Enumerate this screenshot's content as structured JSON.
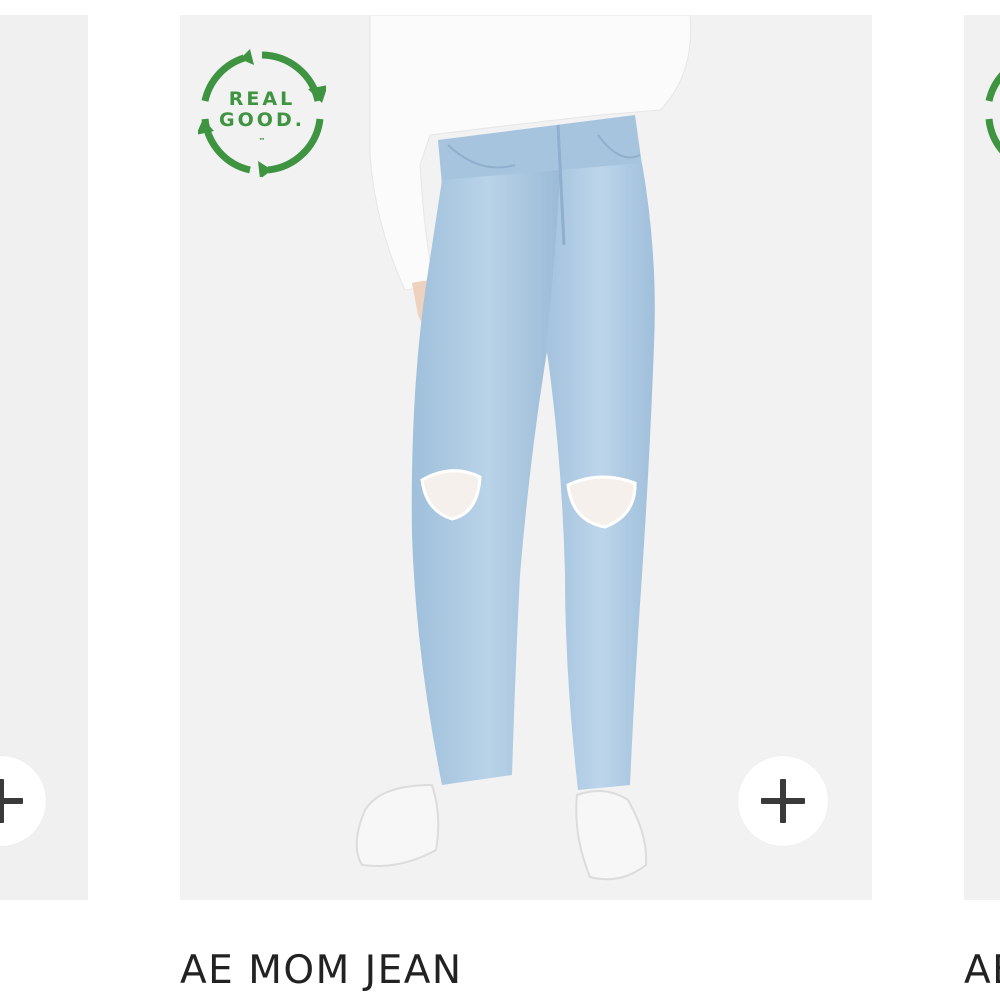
{
  "products": [
    {
      "position": "left-partial",
      "icons": {
        "quick_add": "plus-icon"
      }
    },
    {
      "position": "center",
      "name": "AE MOM JEAN",
      "badge": {
        "line1": "REAL",
        "line2": "GOOD.",
        "mark": "™",
        "color": "#3e9440"
      },
      "icons": {
        "quick_add": "plus-icon",
        "badge": "recycle-arrows-icon"
      },
      "image": {
        "description_colors": {
          "denim": "#a9c6df",
          "background": "#f1f1f1"
        }
      }
    },
    {
      "position": "right-partial",
      "name": "AE",
      "icons": {
        "badge": "recycle-arrows-icon"
      }
    }
  ],
  "colors": {
    "text": "#222222",
    "badge_green": "#3e9440",
    "image_bg": "#f1f1f1",
    "button_bg": "#ffffff",
    "button_icon": "#3a3a3a"
  }
}
